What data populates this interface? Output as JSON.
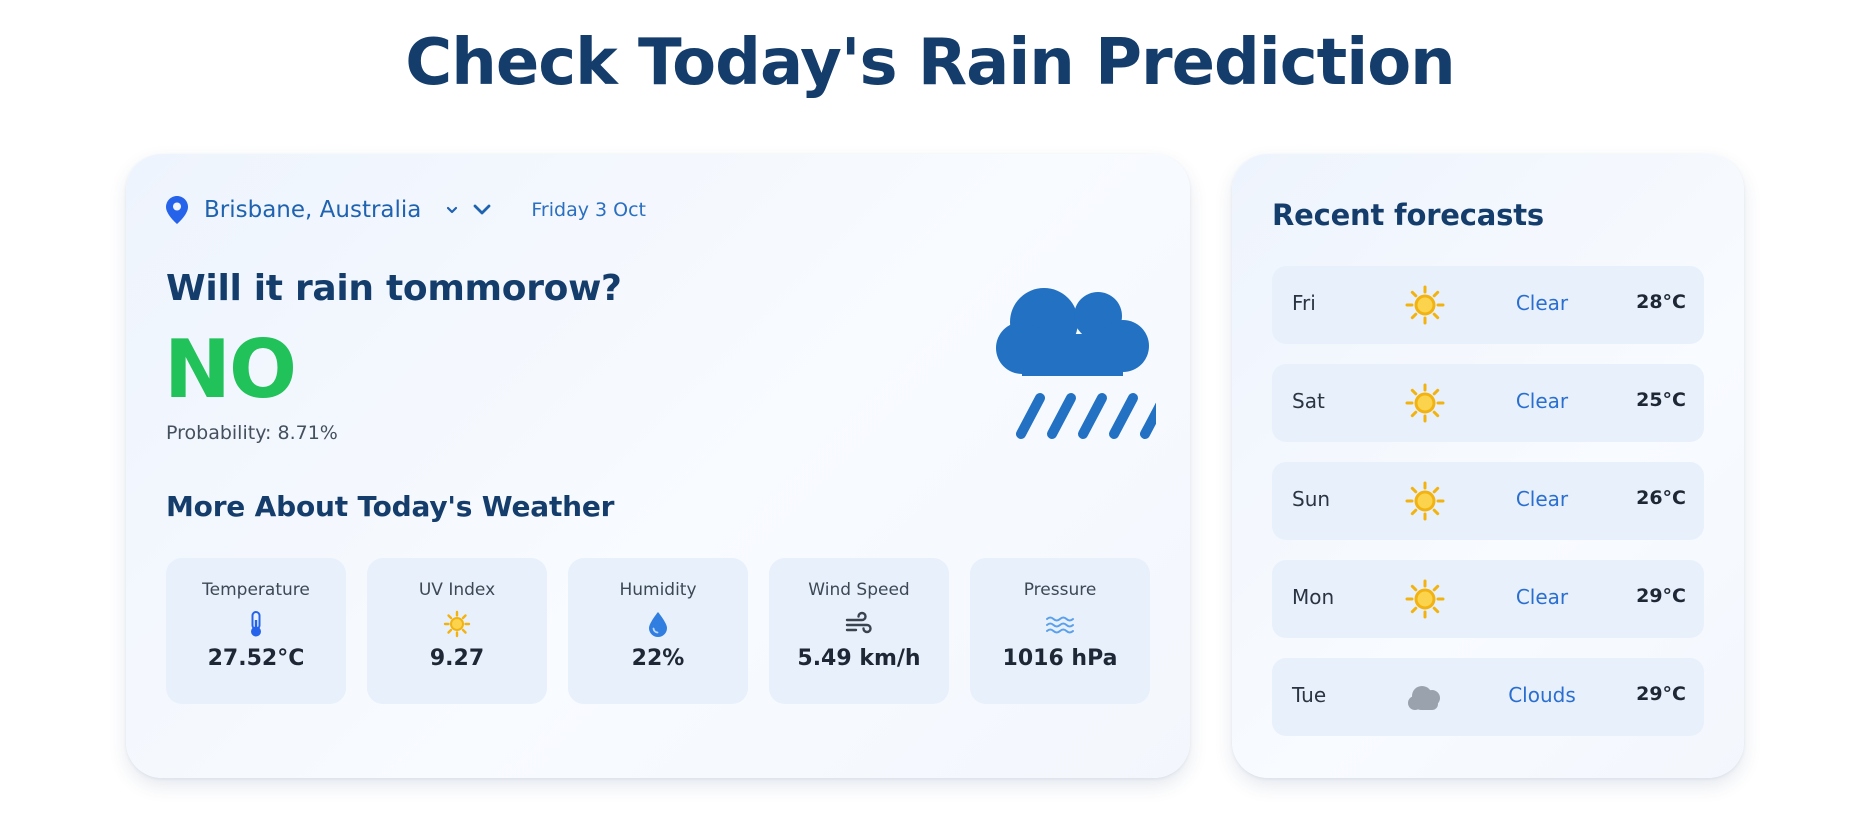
{
  "page": {
    "title": "Check Today's Rain Prediction"
  },
  "colors": {
    "title": "#143d6c",
    "accent_blue": "#1f63b0",
    "yes_no_green": "#22c25a",
    "sun": "#f2b311",
    "cloud_grey": "#9aa3ad",
    "rain_cloud": "#2271c3"
  },
  "location": {
    "icon": "map-pin-icon",
    "city": "Brisbane, Australia",
    "date": "Friday 3 Oct"
  },
  "prediction": {
    "question": "Will it rain tommorow?",
    "answer": "NO",
    "probability": "Probability: 8.71%",
    "icon": "rain-cloud-icon"
  },
  "weather": {
    "section_title": "More About Today's Weather",
    "metrics": [
      {
        "label": "Temperature",
        "value": "27.52°C",
        "icon": "thermometer-icon"
      },
      {
        "label": "UV Index",
        "value": "9.27",
        "icon": "sun-icon"
      },
      {
        "label": "Humidity",
        "value": "22%",
        "icon": "droplet-icon"
      },
      {
        "label": "Wind Speed",
        "value": "5.49 km/h",
        "icon": "wind-icon"
      },
      {
        "label": "Pressure",
        "value": "1016 hPa",
        "icon": "waves-icon"
      }
    ]
  },
  "forecasts": {
    "title": "Recent forecasts",
    "items": [
      {
        "day": "Fri",
        "condition": "Clear",
        "temp": "28°C",
        "icon": "sun-icon"
      },
      {
        "day": "Sat",
        "condition": "Clear",
        "temp": "25°C",
        "icon": "sun-icon"
      },
      {
        "day": "Sun",
        "condition": "Clear",
        "temp": "26°C",
        "icon": "sun-icon"
      },
      {
        "day": "Mon",
        "condition": "Clear",
        "temp": "29°C",
        "icon": "sun-icon"
      },
      {
        "day": "Tue",
        "condition": "Clouds",
        "temp": "29°C",
        "icon": "cloud-icon"
      }
    ]
  }
}
